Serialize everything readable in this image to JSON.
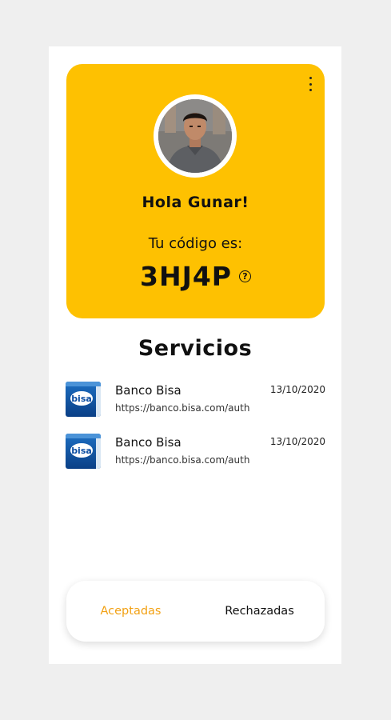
{
  "colors": {
    "accent": "#fec101",
    "active_tab": "#f2a114"
  },
  "profile": {
    "greeting": "Hola Gunar!",
    "code_label": "Tu código es:",
    "code": "3HJ4P",
    "help_icon": "question-circle-icon",
    "menu_icon": "more-vertical-icon"
  },
  "services": {
    "title": "Servicios",
    "items": [
      {
        "name": "Banco Bisa",
        "url": "https://banco.bisa.com/auth",
        "date": "13/10/2020",
        "logo_text": "bisa"
      },
      {
        "name": "Banco Bisa",
        "url": "https://banco.bisa.com/auth",
        "date": "13/10/2020",
        "logo_text": "bisa"
      }
    ]
  },
  "tabs": {
    "accepted": "Aceptadas",
    "rejected": "Rechazadas",
    "active": "Aceptadas"
  }
}
